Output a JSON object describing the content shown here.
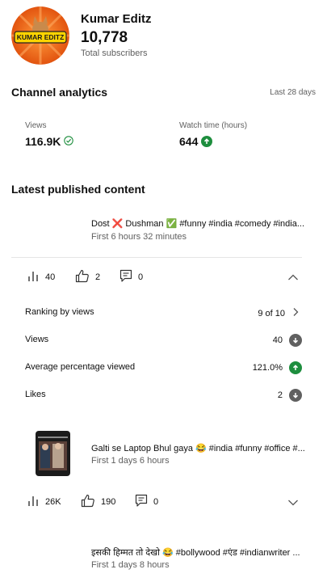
{
  "channel": {
    "name": "Kumar Editz",
    "subscriber_count": "10,778",
    "subscriber_label": "Total subscribers",
    "avatar_text": "KUMAR EDITZ"
  },
  "analytics": {
    "title": "Channel analytics",
    "period": "Last 28 days",
    "views_label": "Views",
    "views_value": "116.9K",
    "watch_label": "Watch time (hours)",
    "watch_value": "644"
  },
  "latest": {
    "title": "Latest published content",
    "items": [
      {
        "title": "Dost ❌ Dushman ✅ #funny #india #comedy #india...",
        "time": "First 6 hours 32 minutes",
        "views": "40",
        "likes": "2",
        "comments": "0",
        "details": {
          "ranking_label": "Ranking by views",
          "ranking_value": "9 of 10",
          "views_label": "Views",
          "views_value": "40",
          "avg_label": "Average percentage viewed",
          "avg_value": "121.0%",
          "likes_label": "Likes",
          "likes_value": "2"
        }
      },
      {
        "title": "Galti se Laptop Bhul gaya 😂 #india #funny #office #...",
        "time": "First 1 days 6 hours",
        "views": "26K",
        "likes": "190",
        "comments": "0"
      },
      {
        "title": "इसकी हिम्मत तो देखो 😂 #bollywood #एंड #indianwriter ...",
        "time": "First 1 days 8 hours"
      }
    ]
  },
  "colors": {
    "up": "#1e8e3e",
    "down": "#606060",
    "avatar_bg": "#f26a1b"
  }
}
